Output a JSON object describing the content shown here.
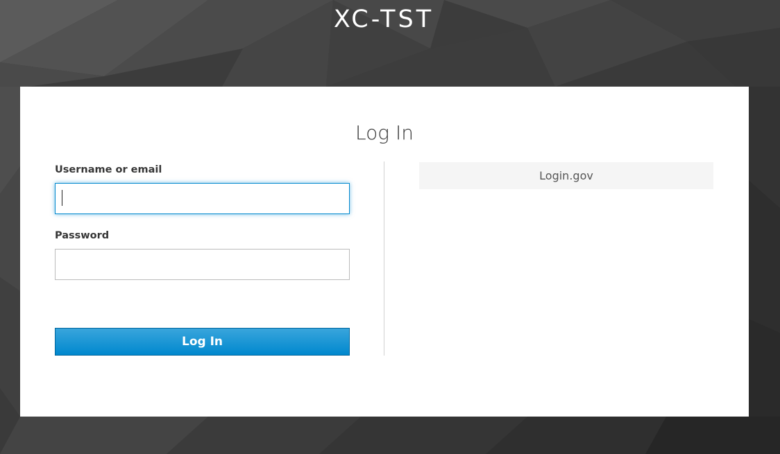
{
  "realm": {
    "title": "XC-TST"
  },
  "login_form": {
    "heading": "Log In",
    "username_label": "Username or email",
    "username_value": "",
    "password_label": "Password",
    "password_value": "",
    "submit_label": "Log In"
  },
  "identity_providers": [
    {
      "label": "Login.gov"
    }
  ],
  "colors": {
    "primary_button": "#0088ce",
    "primary_button_border": "#00659c",
    "focus_border": "#0088ce",
    "provider_button_bg": "#f5f5f5",
    "card_bg": "#ffffff",
    "background": "#3a3a3a"
  }
}
